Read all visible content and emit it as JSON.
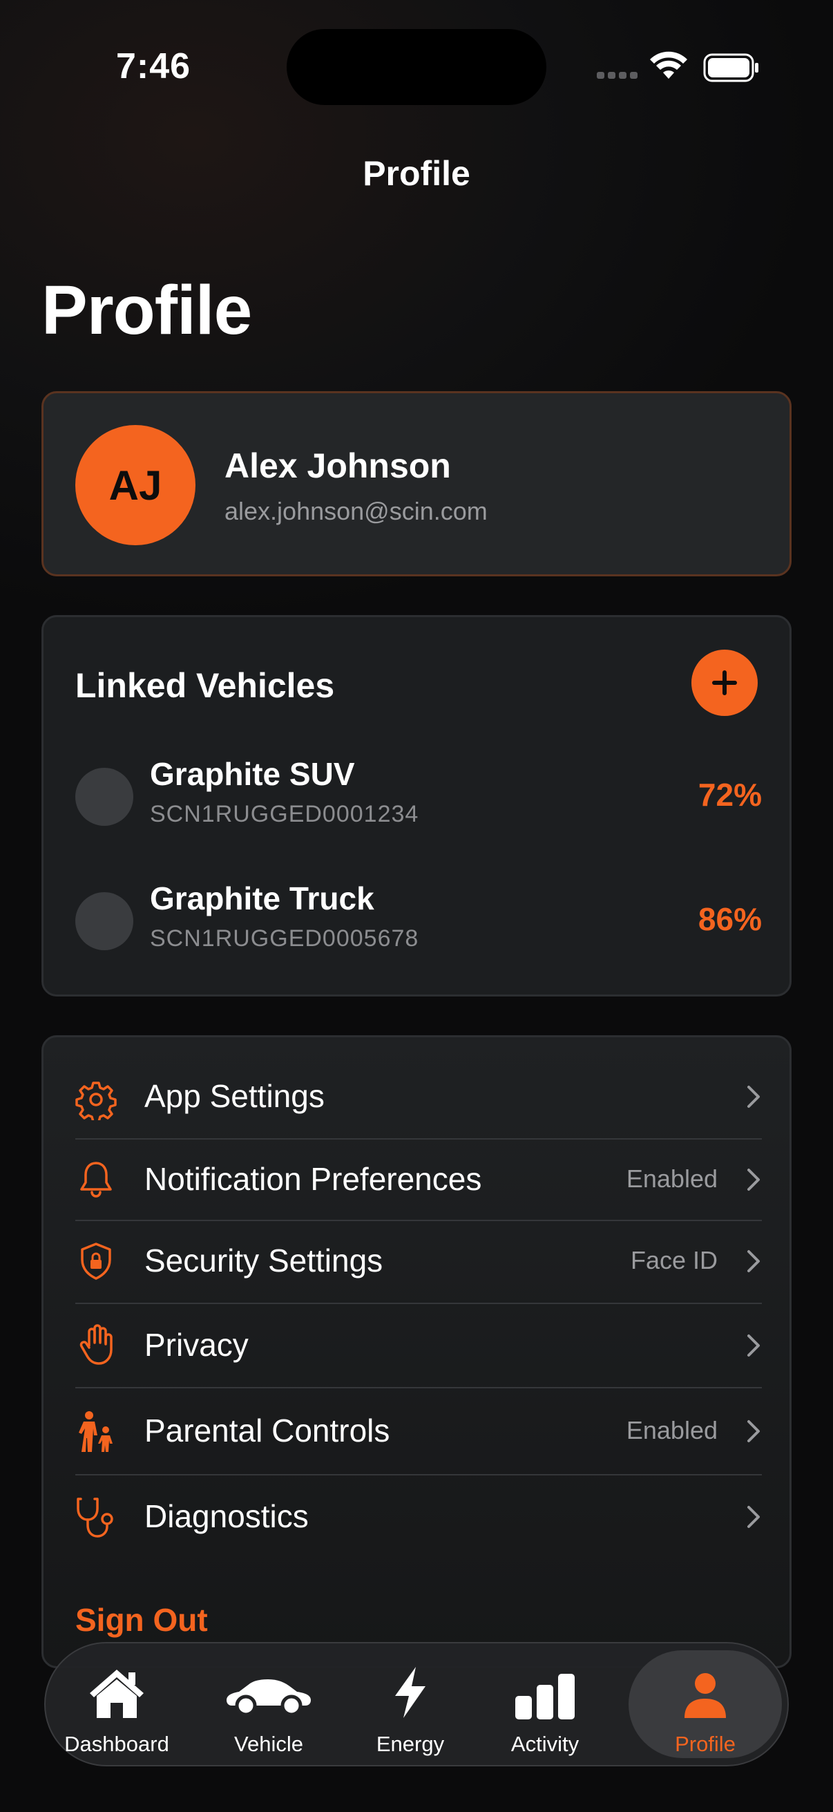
{
  "status_bar": {
    "time": "7:46"
  },
  "nav": {
    "title": "Profile"
  },
  "page": {
    "large_title": "Profile"
  },
  "profile": {
    "initials": "AJ",
    "name": "Alex Johnson",
    "email": "alex.johnson@scin.com"
  },
  "vehicles": {
    "title": "Linked Vehicles",
    "items": [
      {
        "name": "Graphite SUV",
        "vin": "SCN1RUGGED0001234",
        "charge": "72%"
      },
      {
        "name": "Graphite Truck",
        "vin": "SCN1RUGGED0005678",
        "charge": "86%"
      }
    ]
  },
  "settings": {
    "items": [
      {
        "label": "App Settings",
        "value": "",
        "icon": "gear-icon"
      },
      {
        "label": "Notification Preferences",
        "value": "Enabled",
        "icon": "bell-icon"
      },
      {
        "label": "Security Settings",
        "value": "Face ID",
        "icon": "shield-lock-icon"
      },
      {
        "label": "Privacy",
        "value": "",
        "icon": "hand-icon"
      },
      {
        "label": "Parental Controls",
        "value": "Enabled",
        "icon": "parent-child-icon"
      },
      {
        "label": "Diagnostics",
        "value": "",
        "icon": "stethoscope-icon"
      }
    ],
    "sign_out": "Sign Out"
  },
  "tab_bar": {
    "tabs": [
      {
        "label": "Dashboard",
        "icon": "house-icon"
      },
      {
        "label": "Vehicle",
        "icon": "car-icon"
      },
      {
        "label": "Energy",
        "icon": "bolt-icon"
      },
      {
        "label": "Activity",
        "icon": "bar-chart-icon"
      },
      {
        "label": "Profile",
        "icon": "person-icon"
      }
    ],
    "active": "Profile"
  },
  "colors": {
    "accent": "#f4641f",
    "background": "#0c0c0d",
    "card": "#1c1e20",
    "secondary_text": "#9a9b9e"
  }
}
